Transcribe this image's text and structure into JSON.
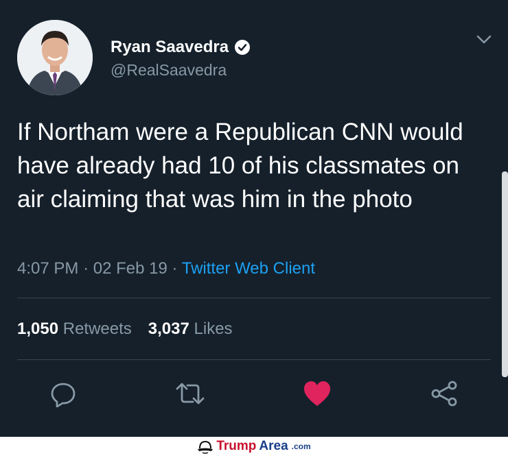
{
  "user": {
    "display_name": "Ryan Saavedra",
    "handle": "@RealSaavedra",
    "verified": true
  },
  "tweet": {
    "text": "If Northam were a Republican CNN would have already had 10 of his classmates on air claiming that was him in the photo",
    "time": "4:07 PM",
    "date": "02 Feb 19",
    "separator": "·",
    "source": "Twitter Web Client"
  },
  "stats": {
    "retweets_count": "1,050",
    "retweets_label": "Retweets",
    "likes_count": "3,037",
    "likes_label": "Likes"
  },
  "actions": [
    {
      "name": "reply",
      "icon": "reply-icon"
    },
    {
      "name": "retweet",
      "icon": "retweet-icon"
    },
    {
      "name": "like",
      "icon": "heart-icon",
      "active": true
    },
    {
      "name": "share",
      "icon": "share-icon"
    }
  ],
  "colors": {
    "background": "#15202b",
    "secondary_text": "#8899a6",
    "link": "#1da1f2",
    "like_active": "#e0245e"
  },
  "footer": {
    "brand_part1": "Trump",
    "brand_part2": "Area",
    "brand_suffix": ".com"
  }
}
